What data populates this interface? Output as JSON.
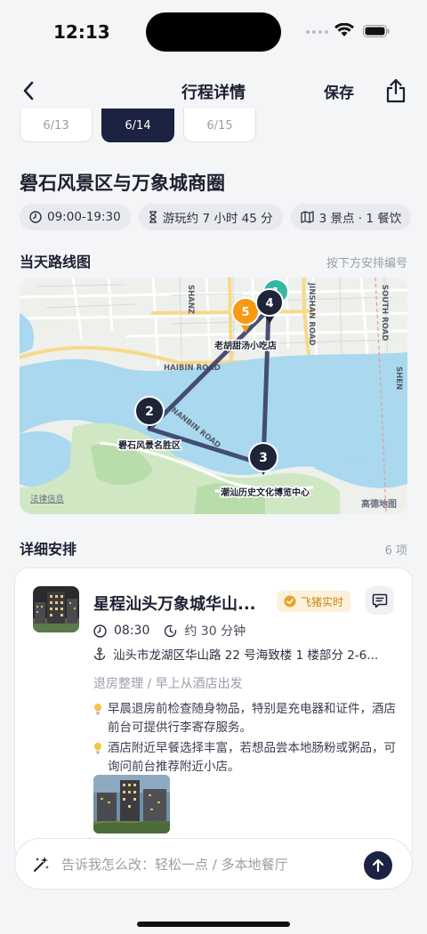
{
  "status_bar": {
    "time": "12:13"
  },
  "nav": {
    "title": "行程详情",
    "save_label": "保存"
  },
  "date_tabs": [
    {
      "label": "6/13",
      "active": false
    },
    {
      "label": "6/14",
      "active": true
    },
    {
      "label": "6/15",
      "active": false
    }
  ],
  "day": {
    "title": "礐石风景区与万象城商圈",
    "chips": [
      {
        "icon": "clock-icon",
        "text": "09:00-19:30"
      },
      {
        "icon": "hourglass-icon",
        "text": "游玩约 7 小时 45 分"
      },
      {
        "icon": "map-icon",
        "text": "3 景点 · 1 餐饮"
      }
    ]
  },
  "route_map": {
    "title": "当天路线图",
    "hint": "按下方安排编号",
    "road_labels": [
      "SHANZ",
      "JINSHAN ROAD",
      "SOUTH ROAD",
      "HAIBIN ROAD",
      "NANBIN ROAD",
      "SHEN"
    ],
    "pois": [
      {
        "number": "1",
        "label": ""
      },
      {
        "number": "2",
        "label": "礐石风景名胜区"
      },
      {
        "number": "3",
        "label": "潮汕历史文化博览中心"
      },
      {
        "number": "4",
        "label": "老胡甜汤小吃店"
      },
      {
        "number": "5",
        "label": ""
      }
    ],
    "legal_text": "法律信息",
    "provider_text": "高德地图",
    "colors": {
      "route": "#3b4268",
      "marker": "#1f2438",
      "marker_orange": "#f59a12",
      "marker_teal": "#35b7a5",
      "water": "#a9d8ef",
      "green": "#cfe8c3"
    }
  },
  "schedule": {
    "title": "详细安排",
    "count": "6 项",
    "first_item": {
      "name": "星程汕头万象城华山...",
      "badge": "飞猪实时",
      "time": "08:30",
      "duration": "约 30 分钟",
      "address": "汕头市龙湖区华山路 22 号海致楼 1 楼部分 2-6...",
      "description": "退房整理 / 早上从酒店出发",
      "tips": [
        "早晨退房前检查随身物品，特别是充电器和证件，酒店前台可提供行李寄存服务。",
        "酒店附近早餐选择丰富，若想品尝本地肠粉或粥品，可询问前台推荐附近小店。"
      ]
    }
  },
  "chat_input": {
    "placeholder": "告诉我怎么改：轻松一点 / 多本地餐厅"
  }
}
